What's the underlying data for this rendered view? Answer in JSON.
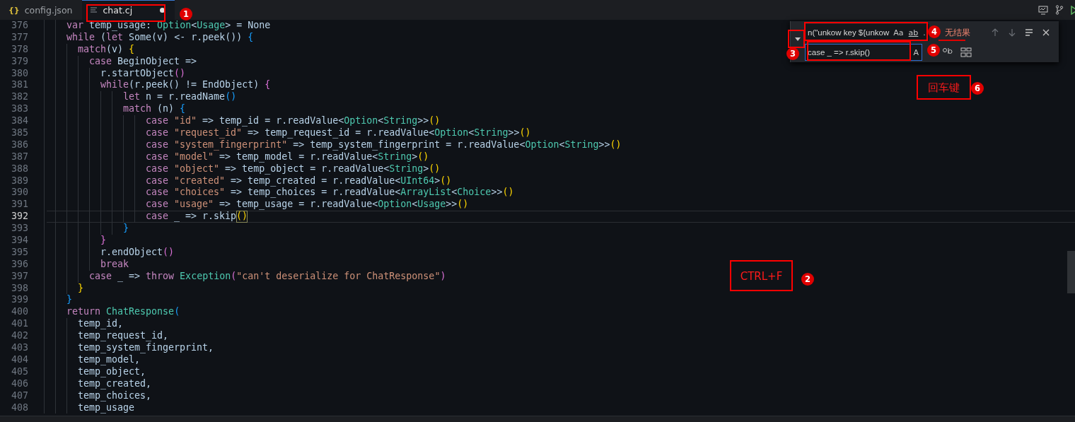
{
  "tabs": [
    {
      "label": "config.json",
      "kind": "json",
      "icon": "{}",
      "selected": false,
      "modified": false
    },
    {
      "label": "chat.cj",
      "kind": "text",
      "selected": true,
      "modified": true
    }
  ],
  "editor": {
    "lines": [
      {
        "number": "376",
        "current": false,
        "tokens": [
          {
            "kind": "kw",
            "text": "    var"
          },
          {
            "kind": "id",
            "text": " temp_usage: "
          },
          {
            "kind": "type",
            "text": "Option"
          },
          {
            "kind": "id",
            "text": "<"
          },
          {
            "kind": "type",
            "text": "Usage"
          },
          {
            "kind": "id",
            "text": "> = None"
          }
        ]
      },
      {
        "number": "377",
        "current": false,
        "tokens": [
          {
            "kind": "kw",
            "text": "    while"
          },
          {
            "kind": "id",
            "text": " ("
          },
          {
            "kind": "kw",
            "text": "let"
          },
          {
            "kind": "id",
            "text": " Some(v) <- r.peek()) "
          },
          {
            "kind": "b3",
            "text": "{"
          }
        ]
      },
      {
        "number": "378",
        "current": false,
        "tokens": [
          {
            "kind": "kw",
            "text": "      match"
          },
          {
            "kind": "id",
            "text": "(v) "
          },
          {
            "kind": "b1",
            "text": "{"
          }
        ]
      },
      {
        "number": "379",
        "current": false,
        "tokens": [
          {
            "kind": "kw",
            "text": "        case"
          },
          {
            "kind": "id",
            "text": " BeginObject =>"
          }
        ]
      },
      {
        "number": "380",
        "current": false,
        "tokens": [
          {
            "kind": "id",
            "text": "          r.startObject"
          },
          {
            "kind": "b2",
            "text": "()"
          }
        ]
      },
      {
        "number": "381",
        "current": false,
        "tokens": [
          {
            "kind": "kw",
            "text": "          while"
          },
          {
            "kind": "id",
            "text": "(r.peek() != EndObject) "
          },
          {
            "kind": "b2",
            "text": "{"
          }
        ]
      },
      {
        "number": "382",
        "current": false,
        "tokens": [
          {
            "kind": "kw",
            "text": "              let"
          },
          {
            "kind": "id",
            "text": " n = r.readName"
          },
          {
            "kind": "b3",
            "text": "()"
          }
        ]
      },
      {
        "number": "383",
        "current": false,
        "tokens": [
          {
            "kind": "kw",
            "text": "              match"
          },
          {
            "kind": "id",
            "text": " (n) "
          },
          {
            "kind": "b3",
            "text": "{"
          }
        ]
      },
      {
        "number": "384",
        "current": false,
        "tokens": [
          {
            "kind": "kw",
            "text": "                  case"
          },
          {
            "kind": "str",
            "text": " \"id\""
          },
          {
            "kind": "id",
            "text": " => temp_id = r.readValue<"
          },
          {
            "kind": "type",
            "text": "Option"
          },
          {
            "kind": "id",
            "text": "<"
          },
          {
            "kind": "type",
            "text": "String"
          },
          {
            "kind": "id",
            "text": ">>"
          },
          {
            "kind": "b1",
            "text": "()"
          }
        ]
      },
      {
        "number": "385",
        "current": false,
        "tokens": [
          {
            "kind": "kw",
            "text": "                  case"
          },
          {
            "kind": "str",
            "text": " \"request_id\""
          },
          {
            "kind": "id",
            "text": " => temp_request_id = r.readValue<"
          },
          {
            "kind": "type",
            "text": "Option"
          },
          {
            "kind": "id",
            "text": "<"
          },
          {
            "kind": "type",
            "text": "String"
          },
          {
            "kind": "id",
            "text": ">>"
          },
          {
            "kind": "b1",
            "text": "()"
          }
        ]
      },
      {
        "number": "386",
        "current": false,
        "tokens": [
          {
            "kind": "kw",
            "text": "                  case"
          },
          {
            "kind": "str",
            "text": " \"system_fingerprint\""
          },
          {
            "kind": "id",
            "text": " => temp_system_fingerprint = r.readValue<"
          },
          {
            "kind": "type",
            "text": "Option"
          },
          {
            "kind": "id",
            "text": "<"
          },
          {
            "kind": "type",
            "text": "String"
          },
          {
            "kind": "id",
            "text": ">>"
          },
          {
            "kind": "b1",
            "text": "()"
          }
        ]
      },
      {
        "number": "387",
        "current": false,
        "tokens": [
          {
            "kind": "kw",
            "text": "                  case"
          },
          {
            "kind": "str",
            "text": " \"model\""
          },
          {
            "kind": "id",
            "text": " => temp_model = r.readValue<"
          },
          {
            "kind": "type",
            "text": "String"
          },
          {
            "kind": "id",
            "text": ">"
          },
          {
            "kind": "b1",
            "text": "()"
          }
        ]
      },
      {
        "number": "388",
        "current": false,
        "tokens": [
          {
            "kind": "kw",
            "text": "                  case"
          },
          {
            "kind": "str",
            "text": " \"object\""
          },
          {
            "kind": "id",
            "text": " => temp_object = r.readValue<"
          },
          {
            "kind": "type",
            "text": "String"
          },
          {
            "kind": "id",
            "text": ">"
          },
          {
            "kind": "b1",
            "text": "()"
          }
        ]
      },
      {
        "number": "389",
        "current": false,
        "tokens": [
          {
            "kind": "kw",
            "text": "                  case"
          },
          {
            "kind": "str",
            "text": " \"created\""
          },
          {
            "kind": "id",
            "text": " => temp_created = r.readValue<"
          },
          {
            "kind": "type",
            "text": "UInt64"
          },
          {
            "kind": "id",
            "text": ">"
          },
          {
            "kind": "b1",
            "text": "()"
          }
        ]
      },
      {
        "number": "390",
        "current": false,
        "tokens": [
          {
            "kind": "kw",
            "text": "                  case"
          },
          {
            "kind": "str",
            "text": " \"choices\""
          },
          {
            "kind": "id",
            "text": " => temp_choices = r.readValue<"
          },
          {
            "kind": "type",
            "text": "ArrayList"
          },
          {
            "kind": "id",
            "text": "<"
          },
          {
            "kind": "type",
            "text": "Choice"
          },
          {
            "kind": "id",
            "text": ">>"
          },
          {
            "kind": "b1",
            "text": "()"
          }
        ]
      },
      {
        "number": "391",
        "current": false,
        "tokens": [
          {
            "kind": "kw",
            "text": "                  case"
          },
          {
            "kind": "str",
            "text": " \"usage\""
          },
          {
            "kind": "id",
            "text": " => temp_usage = r.readValue<"
          },
          {
            "kind": "type",
            "text": "Option"
          },
          {
            "kind": "id",
            "text": "<"
          },
          {
            "kind": "type",
            "text": "Usage"
          },
          {
            "kind": "id",
            "text": ">>"
          },
          {
            "kind": "b1",
            "text": "()"
          }
        ]
      },
      {
        "number": "392",
        "current": true,
        "tokens": [
          {
            "kind": "kw",
            "text": "                  case"
          },
          {
            "kind": "id",
            "text": " _ => r.skip"
          },
          {
            "kind": "match",
            "text": "()"
          }
        ]
      },
      {
        "number": "393",
        "current": false,
        "tokens": [
          {
            "kind": "b3",
            "text": "              }"
          }
        ]
      },
      {
        "number": "394",
        "current": false,
        "tokens": [
          {
            "kind": "b2",
            "text": "          }"
          }
        ]
      },
      {
        "number": "395",
        "current": false,
        "tokens": [
          {
            "kind": "id",
            "text": "          r.endObject"
          },
          {
            "kind": "b2",
            "text": "()"
          }
        ]
      },
      {
        "number": "396",
        "current": false,
        "tokens": [
          {
            "kind": "kw",
            "text": "          break"
          }
        ]
      },
      {
        "number": "397",
        "current": false,
        "tokens": [
          {
            "kind": "kw",
            "text": "        case"
          },
          {
            "kind": "id",
            "text": " _ => "
          },
          {
            "kind": "kw",
            "text": "throw"
          },
          {
            "kind": "type",
            "text": " Exception"
          },
          {
            "kind": "b2",
            "text": "("
          },
          {
            "kind": "str",
            "text": "\"can't deserialize for ChatResponse\""
          },
          {
            "kind": "b2",
            "text": ")"
          }
        ]
      },
      {
        "number": "398",
        "current": false,
        "tokens": [
          {
            "kind": "b1",
            "text": "      }"
          }
        ]
      },
      {
        "number": "399",
        "current": false,
        "tokens": [
          {
            "kind": "b3",
            "text": "    }"
          }
        ]
      },
      {
        "number": "400",
        "current": false,
        "tokens": [
          {
            "kind": "kw",
            "text": "    return"
          },
          {
            "kind": "type",
            "text": " ChatResponse"
          },
          {
            "kind": "b3",
            "text": "("
          }
        ]
      },
      {
        "number": "401",
        "current": false,
        "tokens": [
          {
            "kind": "id",
            "text": "      temp_id,"
          }
        ]
      },
      {
        "number": "402",
        "current": false,
        "tokens": [
          {
            "kind": "id",
            "text": "      temp_request_id,"
          }
        ]
      },
      {
        "number": "403",
        "current": false,
        "tokens": [
          {
            "kind": "id",
            "text": "      temp_system_fingerprint,"
          }
        ]
      },
      {
        "number": "404",
        "current": false,
        "tokens": [
          {
            "kind": "id",
            "text": "      temp_model,"
          }
        ]
      },
      {
        "number": "405",
        "current": false,
        "tokens": [
          {
            "kind": "id",
            "text": "      temp_object,"
          }
        ]
      },
      {
        "number": "406",
        "current": false,
        "tokens": [
          {
            "kind": "id",
            "text": "      temp_created,"
          }
        ]
      },
      {
        "number": "407",
        "current": false,
        "tokens": [
          {
            "kind": "id",
            "text": "      temp_choices,"
          }
        ]
      },
      {
        "number": "408",
        "current": false,
        "tokens": [
          {
            "kind": "id",
            "text": "      temp_usage"
          }
        ]
      }
    ]
  },
  "find_widget": {
    "replace_expanded": true,
    "find_value": "n(\"unkow key ${unkow",
    "match_case": "Aa",
    "whole_word": "ab",
    "regex": ".",
    "result": "无结果",
    "replace_value": "case _ => r.skip()",
    "preserve_case": "A"
  },
  "annotations": [
    {
      "number": "1"
    },
    {
      "number": "2",
      "text": "CTRL+F"
    },
    {
      "number": "3"
    },
    {
      "number": "4"
    },
    {
      "number": "5"
    },
    {
      "number": "6",
      "text": "回车键"
    }
  ]
}
